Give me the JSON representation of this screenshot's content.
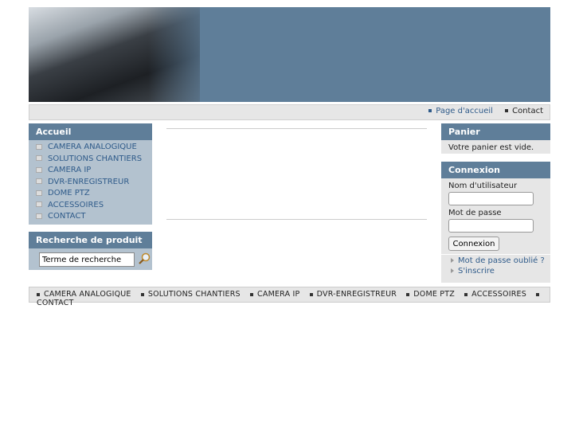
{
  "topnav": [
    {
      "label": "Page d'accueil"
    },
    {
      "label": "Contact"
    }
  ],
  "menu": {
    "title": "Accueil",
    "items": [
      "CAMERA ANALOGIQUE",
      "SOLUTIONS CHANTIERS",
      "CAMERA IP",
      "DVR-ENREGISTREUR",
      "DOME PTZ",
      "ACCESSOIRES",
      "CONTACT"
    ]
  },
  "search": {
    "title": "Recherche de produit",
    "value": "Terme de recherche"
  },
  "cart": {
    "title": "Panier",
    "text": "Votre panier est vide."
  },
  "login": {
    "title": "Connexion",
    "username_label": "Nom d'utilisateur",
    "password_label": "Mot de passe",
    "button": "Connexion",
    "forgot": "Mot de passe oublié ?",
    "register": "S'inscrire"
  },
  "footer": [
    "CAMERA ANALOGIQUE",
    "SOLUTIONS CHANTIERS",
    "CAMERA IP",
    "DVR-ENREGISTREUR",
    "DOME PTZ",
    "ACCESSOIRES",
    "CONTACT"
  ],
  "colors": {
    "header": "#5f7e99",
    "link": "#2f5b8a",
    "menu_bg": "#b3c2cf"
  }
}
